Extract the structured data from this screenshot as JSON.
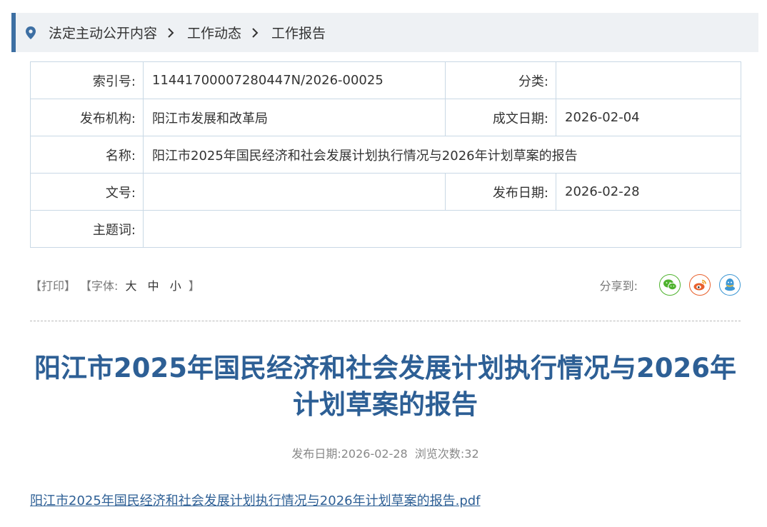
{
  "breadcrumb": {
    "items": [
      "法定主动公开内容",
      "工作动态",
      "工作报告"
    ]
  },
  "meta": {
    "index_label": "索引号:",
    "index_value": "11441700007280447N/2026-00025",
    "category_label": "分类:",
    "category_value": "",
    "publisher_label": "发布机构:",
    "publisher_value": "阳江市发展和改革局",
    "written_date_label": "成文日期:",
    "written_date_value": "2026-02-04",
    "name_label": "名称:",
    "name_value": "阳江市2025年国民经济和社会发展计划执行情况与2026年计划草案的报告",
    "doc_no_label": "文号:",
    "doc_no_value": "",
    "publish_date_label": "发布日期:",
    "publish_date_value": "2026-02-28",
    "keywords_label": "主题词:",
    "keywords_value": ""
  },
  "toolbar": {
    "print": "【打印】",
    "font_size_prefix": "【字体:",
    "font_large": "大",
    "font_medium": "中",
    "font_small": "小",
    "font_size_suffix": "】",
    "share_label": "分享到:",
    "share_icons": [
      "wechat-icon",
      "weibo-icon",
      "qq-icon"
    ]
  },
  "article": {
    "title": "阳江市2025年国民经济和社会发展计划执行情况与2026年计划草案的报告",
    "publish_date_label": "发布日期:",
    "publish_date": "2026-02-28",
    "views_label": "浏览次数:",
    "views": "32",
    "attachment": "阳江市2025年国民经济和社会发展计划执行情况与2026年计划草案的报告.pdf"
  },
  "colors": {
    "accent": "#2d5f95",
    "breadcrumb_bar": "#3d6fa3",
    "breadcrumb_bg": "#eef1f4",
    "table_border": "#c9d8e5",
    "wechat": "#4fb32e",
    "weibo": "#e8602c",
    "qq": "#3d97d4"
  }
}
